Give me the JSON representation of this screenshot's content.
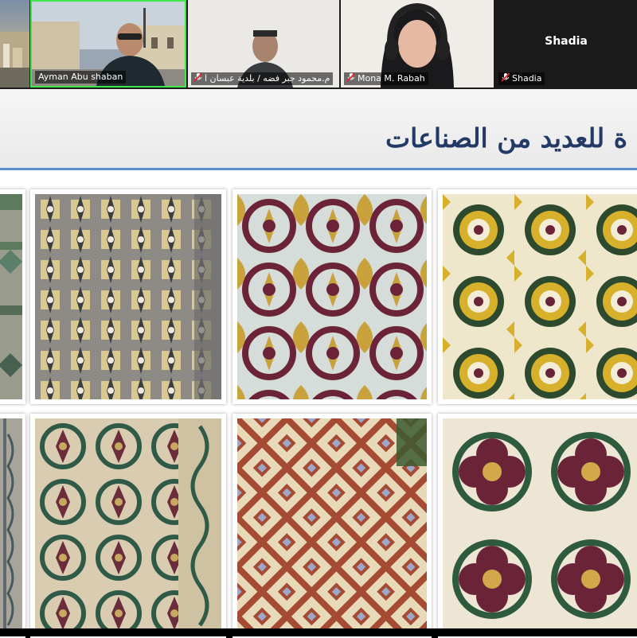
{
  "participants": [
    {
      "name": "Ayman Abu shaban",
      "muted": false,
      "active": true
    },
    {
      "name": "م.محمود جبر فضه / بلدية عبسان ا",
      "muted": true,
      "active": false
    },
    {
      "name": "Mona M. Rabah",
      "muted": true,
      "active": false
    },
    {
      "name": "Shadia",
      "muted": true,
      "active": false,
      "video_off": true
    }
  ],
  "slide": {
    "title": "ة للعديد من الصناعات",
    "photos": [
      {
        "name": "tile-photo-1",
        "pattern": "striped-green"
      },
      {
        "name": "tile-photo-2",
        "pattern": "yellow-grey-lattice"
      },
      {
        "name": "tile-photo-3",
        "pattern": "maroon-yellow-medallion"
      },
      {
        "name": "tile-photo-4",
        "pattern": "yellow-green-rosette"
      },
      {
        "name": "tile-photo-5",
        "pattern": "grey-border"
      },
      {
        "name": "tile-photo-6",
        "pattern": "green-maroon-ornament"
      },
      {
        "name": "tile-photo-7",
        "pattern": "red-cream-star"
      },
      {
        "name": "tile-photo-8",
        "pattern": "maroon-green-quatrefoil"
      }
    ]
  },
  "colors": {
    "active_border": "#3ee84b",
    "divider": "#5c8ec9",
    "title": "#233a66"
  }
}
